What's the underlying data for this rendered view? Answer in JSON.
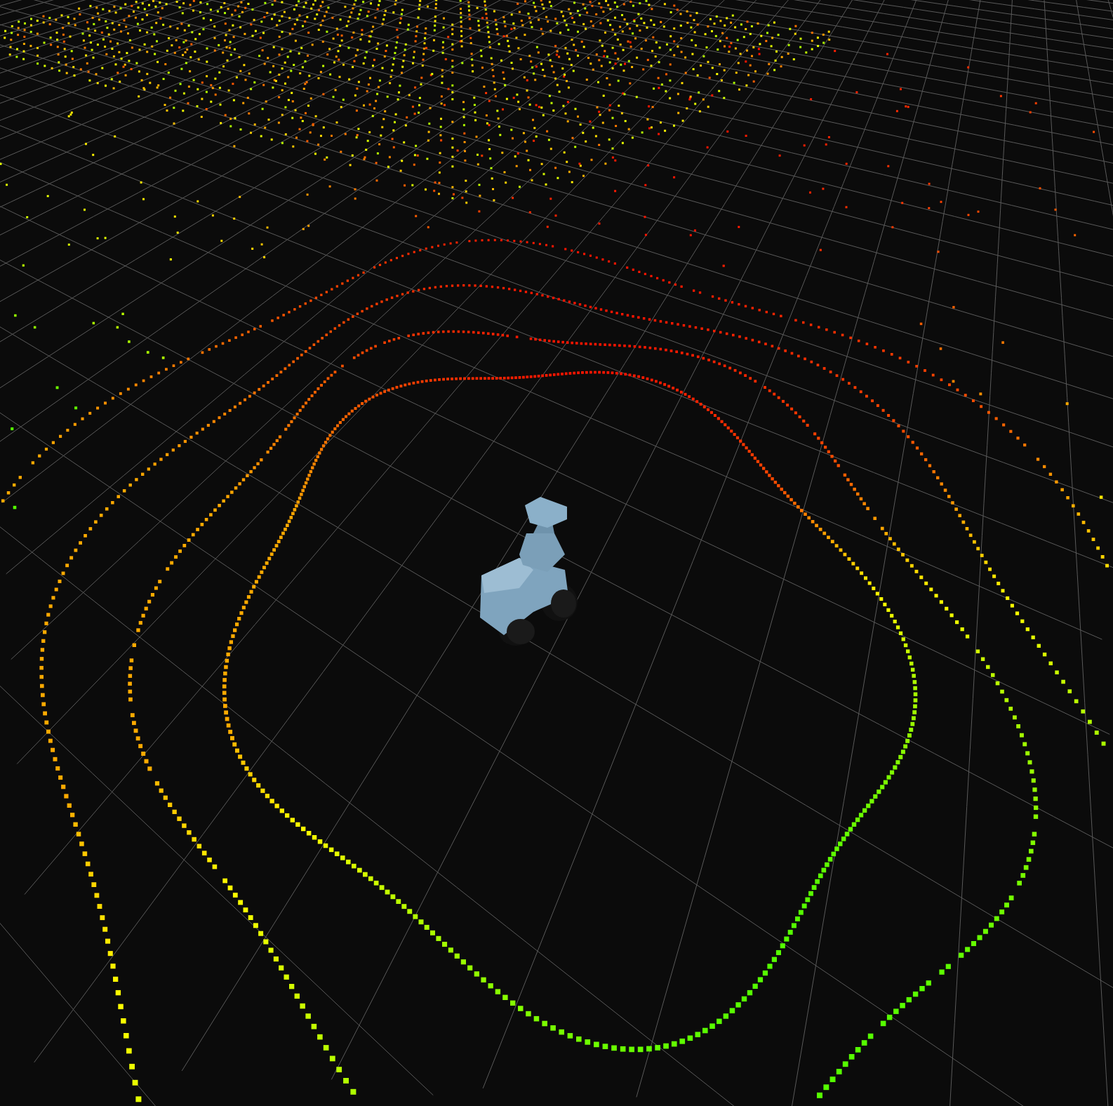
{
  "viewport": {
    "kind": "lidar-scan"
  }
}
